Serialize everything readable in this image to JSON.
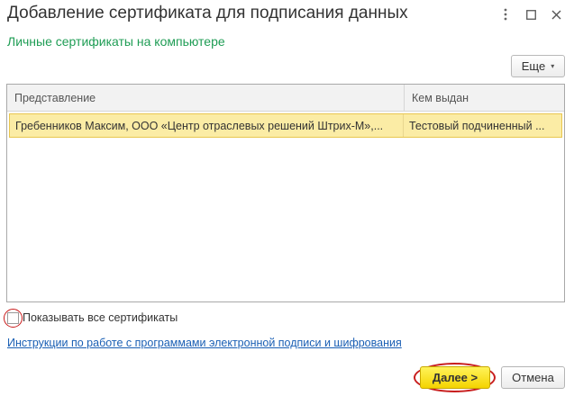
{
  "window": {
    "title": "Добавление сертификата для подписания данных",
    "more_icon": "kebab-vertical",
    "maximize_icon": "maximize-square",
    "close_icon": "close-x"
  },
  "section": {
    "title": "Личные сертификаты на компьютере"
  },
  "toolbar": {
    "more_label": "Еще",
    "more_caret": "▾"
  },
  "table": {
    "columns": [
      "Представление",
      "Кем выдан"
    ],
    "rows": [
      {
        "presentation": "Гребенников Максим, ООО «Центр отраслевых решений Штрих-М»,...",
        "issuer": "Тестовый подчиненный ..."
      }
    ],
    "selected_row_color": "#fbeca5"
  },
  "options": {
    "show_all_label": "Показывать все сертификаты",
    "show_all_checked": false
  },
  "link": {
    "text": "Инструкции по работе с программами электронной подписи и шифрования"
  },
  "buttons": {
    "next_label": "Далее >",
    "cancel_label": "Отмена"
  },
  "colors": {
    "accent_green": "#1f9d55",
    "primary_button": "#f4d400",
    "highlight_red": "#c81e1e",
    "link_blue": "#1a5fb4"
  }
}
